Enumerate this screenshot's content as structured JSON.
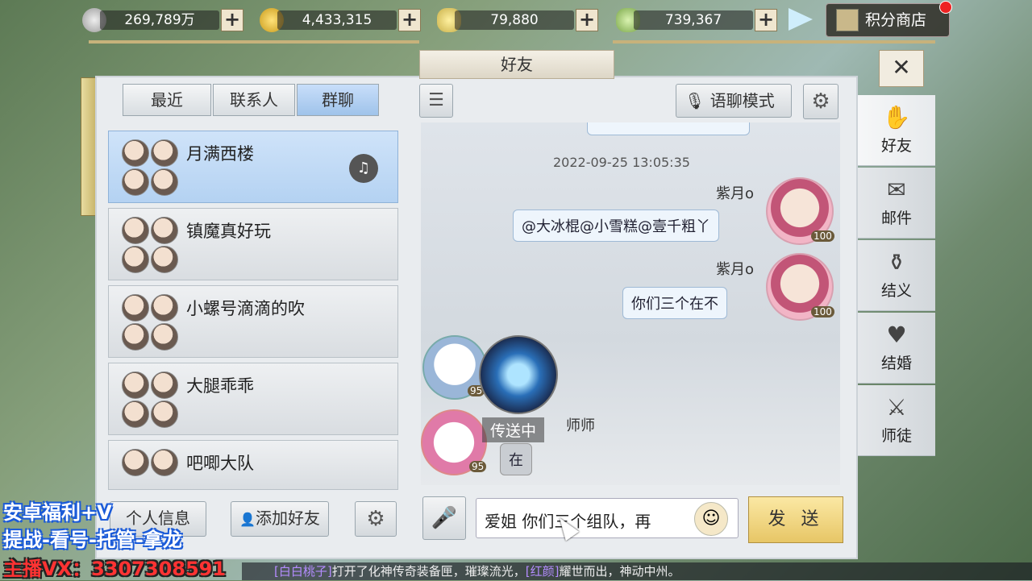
{
  "currencies": [
    {
      "value": "269,789万",
      "icon": "silver-coin-icon"
    },
    {
      "value": "4,433,315",
      "icon": "gold-coin-icon"
    },
    {
      "value": "79,880",
      "icon": "gold-ingot-icon"
    },
    {
      "value": "739,367",
      "icon": "green-ingot-icon"
    }
  ],
  "plus_label": "+",
  "shop_label": "积分商店",
  "panel_title": "好友",
  "close_label": "✕",
  "tabs": [
    "最近",
    "联系人",
    "群聊"
  ],
  "active_tab": "群聊",
  "groups": [
    {
      "name": "月满西楼",
      "selected": true
    },
    {
      "name": "镇魔真好玩"
    },
    {
      "name": "小螺号滴滴的吹"
    },
    {
      "name": "大腿乖乖"
    },
    {
      "name": "吧唧大队"
    }
  ],
  "chat_toolbar": {
    "voice_mode_label": "语聊模式"
  },
  "messages": {
    "timestamp": "2022-09-25 13:05:35",
    "m1": {
      "nick": "紫月o",
      "text": "@大冰棍@小雪糕@壹千粗丫",
      "level": "100"
    },
    "m2": {
      "nick": "紫月o",
      "text": "你们三个在不",
      "level": "100"
    },
    "m3": {
      "nick": "师师",
      "level": "95"
    },
    "m4": {
      "text": "在",
      "level": "95"
    },
    "loading_label": "传送中"
  },
  "bottom": {
    "profile_label": "个人信息",
    "add_friend_label": "添加好友",
    "input_value": "爱姐 你们三个组队，再",
    "send_label": "发 送"
  },
  "side_nav": [
    {
      "label": "好友",
      "icon": "friend-icon",
      "active": true
    },
    {
      "label": "邮件",
      "icon": "mail-icon"
    },
    {
      "label": "结义",
      "icon": "brotherhood-icon"
    },
    {
      "label": "结婚",
      "icon": "marriage-icon"
    },
    {
      "label": "师徒",
      "icon": "mentor-icon"
    }
  ],
  "overlay": {
    "line1": "安卓福利+V",
    "line2": "提战-看号-托管-拿龙",
    "line3": "主播VX：3307308591"
  },
  "ticker": {
    "name1": "[白白桃子]",
    "text1": "打开了化神传奇装备匣，璀璨流光，",
    "name2": "[红颜]",
    "text2": "耀世而出，神动中州。"
  }
}
